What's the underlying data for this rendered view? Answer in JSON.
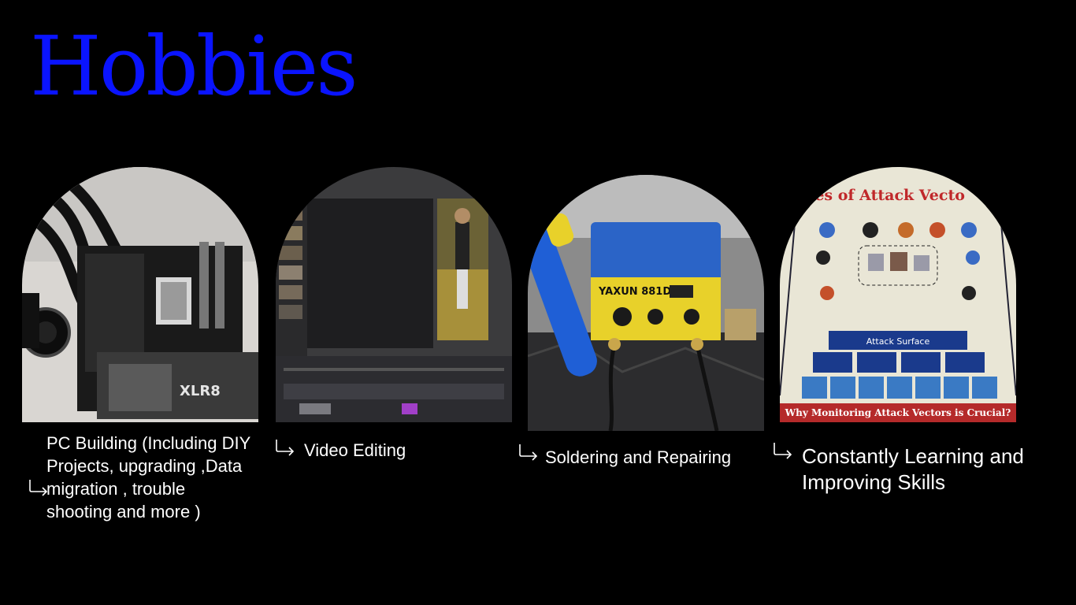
{
  "slide": {
    "title": "Hobbies",
    "title_color": "#0a14ff",
    "background": "#000000"
  },
  "hobbies": [
    {
      "caption": "PC Building (Including DIY Projects, upgrading ,Data migration , trouble shooting and more )",
      "arrow_icon": "return-arrow-icon",
      "photo": "pc-build-photo"
    },
    {
      "caption": "Video Editing",
      "arrow_icon": "return-arrow-icon",
      "photo": "video-editing-photo"
    },
    {
      "caption": "Soldering and Repairing",
      "arrow_icon": "return-arrow-icon",
      "photo": "soldering-station-photo",
      "photo_text": {
        "brand": "YAXUN 881D"
      }
    },
    {
      "caption": "Constantly Learning and Improving Skills",
      "arrow_icon": "return-arrow-icon",
      "photo": "attack-vectors-poster-photo",
      "photo_text": {
        "header": "ypes of Attack Vecto",
        "center": "Attack Surface",
        "footer": "Why Monitoring Attack Vectors is Crucial?"
      }
    }
  ]
}
